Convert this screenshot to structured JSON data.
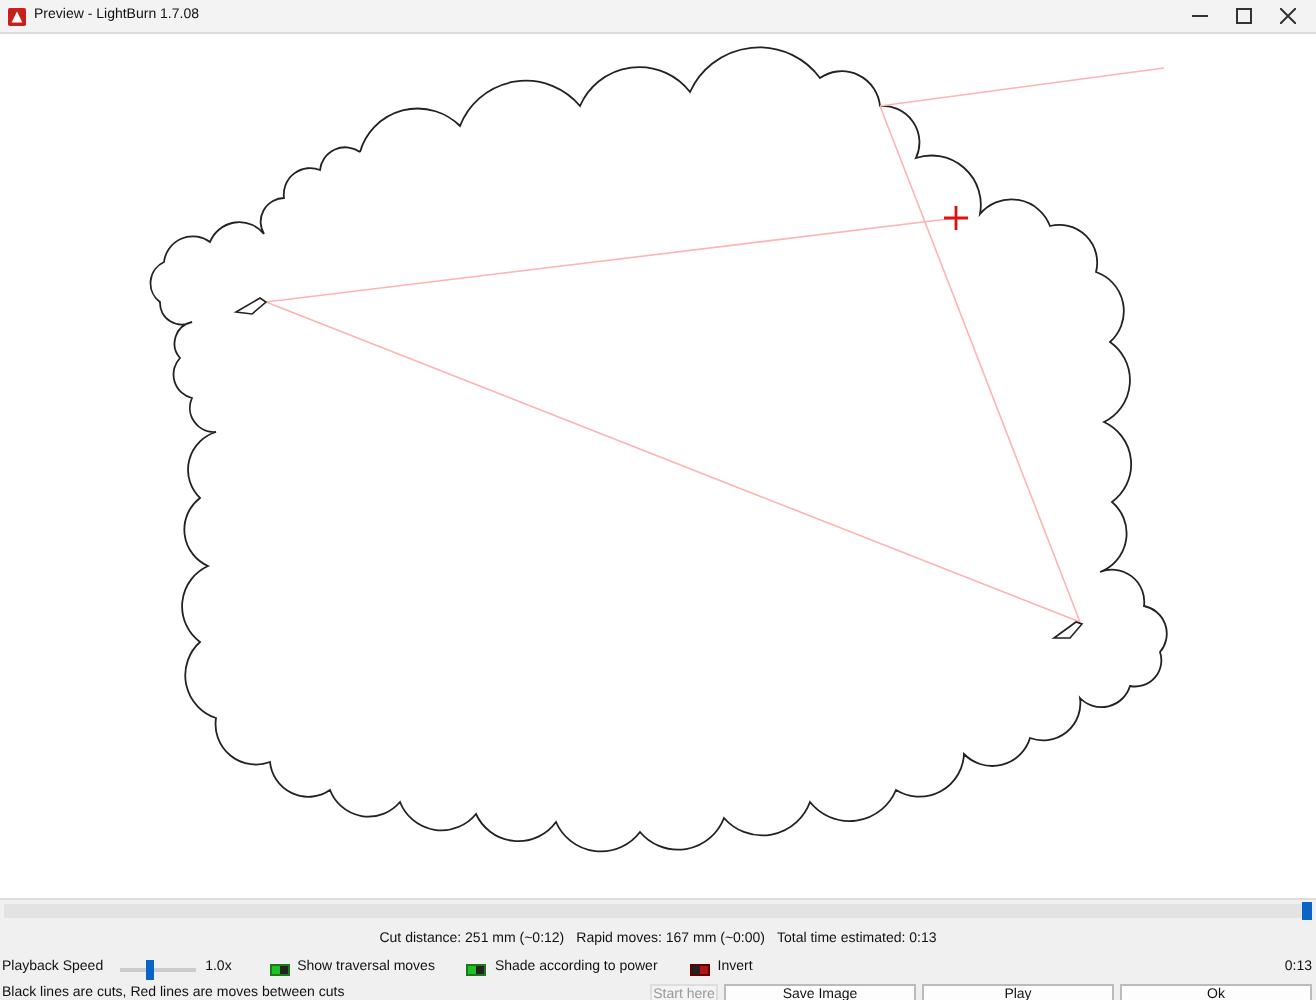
{
  "window": {
    "title": "Preview - LightBurn 1.7.08"
  },
  "timeline": {
    "level": 1
  },
  "stats": [
    "Cut distance: 251 mm (~0:12)",
    "Rapid moves: 167 mm (~0:00)",
    "Total time estimated: 0:13"
  ],
  "playback": {
    "label": "Playback Speed",
    "level": 0.4,
    "reading": "1.0x"
  },
  "toggles": [
    {
      "label": "Show traversal moves",
      "on": true
    },
    {
      "label": "Shade according to power",
      "on": true
    },
    {
      "label": "Invert",
      "on": false
    }
  ],
  "elapsed": "0:13",
  "status_text": "Black lines are cuts, Red lines are moves between cuts",
  "buttons": [
    {
      "label": "Start here",
      "disabled": true
    },
    {
      "label": "Save Image",
      "disabled": false
    },
    {
      "label": "Play",
      "disabled": false
    },
    {
      "label": "Ok",
      "disabled": false
    }
  ]
}
